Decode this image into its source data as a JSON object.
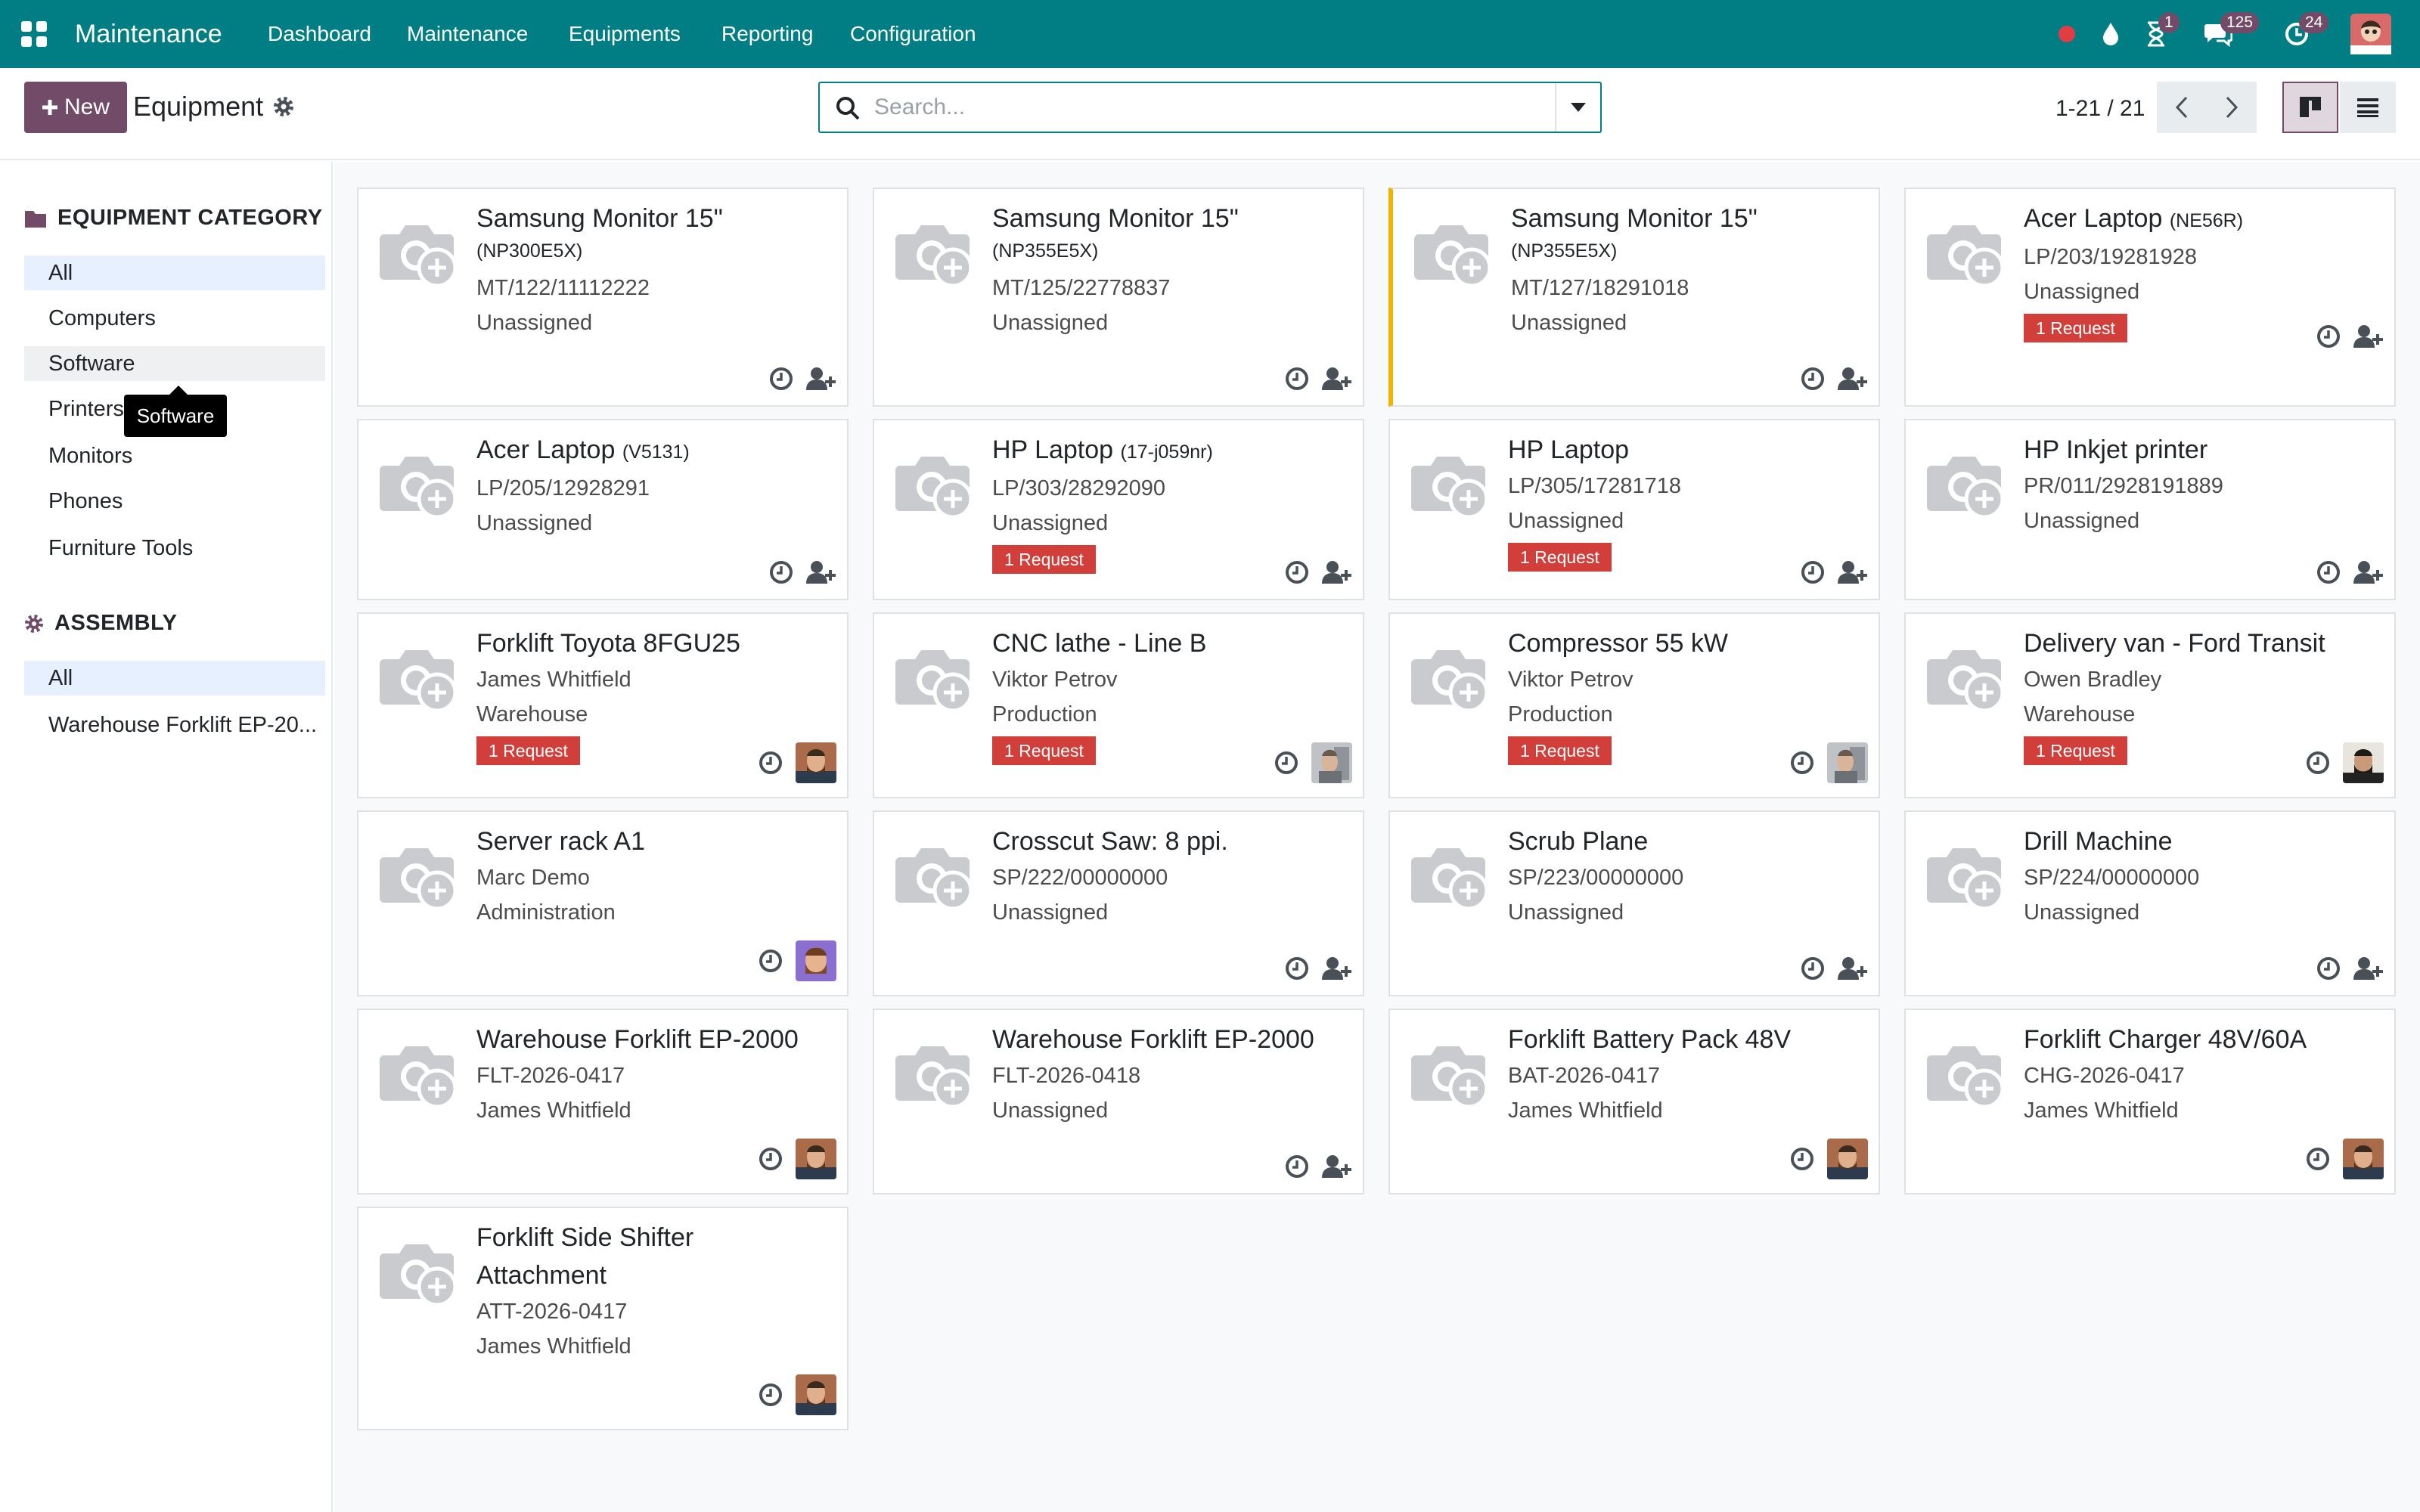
{
  "navbar": {
    "app_title": "Maintenance",
    "menu": [
      "Dashboard",
      "Maintenance",
      "Equipments",
      "Reporting",
      "Configuration"
    ],
    "activity_badge": "1",
    "messages_badge": "125",
    "updates_badge": "24"
  },
  "control_panel": {
    "new_label": "New",
    "breadcrumb": "Equipment",
    "search_placeholder": "Search...",
    "pager": "1-21 / 21"
  },
  "sidebar": {
    "category_title": "EQUIPMENT CATEGORY",
    "categories": [
      "All",
      "Computers",
      "Software",
      "Printers",
      "Monitors",
      "Phones",
      "Furniture Tools"
    ],
    "assembly_title": "ASSEMBLY",
    "assemblies": [
      "All",
      "Warehouse Forklift EP-20..."
    ],
    "tooltip": "Software"
  },
  "cards": [
    {
      "name": "Samsung Monitor 15\"",
      "model": "(NP300E5X)",
      "serial": "MT/122/11112222",
      "owner": "Unassigned"
    },
    {
      "name": "Samsung Monitor 15\"",
      "model": "(NP355E5X)",
      "serial": "MT/125/22778837",
      "owner": "Unassigned"
    },
    {
      "name": "Samsung Monitor 15\"",
      "model": "(NP355E5X)",
      "serial": "MT/127/18291018",
      "owner": "Unassigned"
    },
    {
      "name": "Acer Laptop",
      "model": "(NE56R)",
      "serial": "LP/203/19281928",
      "owner": "Unassigned",
      "request": "1 Request"
    },
    {
      "name": "Acer Laptop",
      "model": "(V5131)",
      "serial": "LP/205/12928291",
      "owner": "Unassigned"
    },
    {
      "name": "HP Laptop",
      "model": "(17-j059nr)",
      "serial": "LP/303/28292090",
      "owner": "Unassigned",
      "request": "1 Request"
    },
    {
      "name": "HP Laptop",
      "model": "",
      "serial": "LP/305/17281718",
      "owner": "Unassigned",
      "request": "1 Request"
    },
    {
      "name": "HP Inkjet printer",
      "model": "",
      "serial": "PR/011/2928191889",
      "owner": "Unassigned"
    },
    {
      "name": "Forklift Toyota 8FGU25",
      "line1": "James Whitfield",
      "line2": "Warehouse",
      "request": "1 Request"
    },
    {
      "name": "CNC lathe - Line B",
      "line1": "Viktor Petrov",
      "line2": "Production",
      "request": "1 Request"
    },
    {
      "name": "Compressor 55 kW",
      "line1": "Viktor Petrov",
      "line2": "Production",
      "request": "1 Request"
    },
    {
      "name": "Delivery van - Ford Transit",
      "line1": "Owen Bradley",
      "line2": "Warehouse",
      "request": "1 Request"
    },
    {
      "name": "Server rack A1",
      "line1": "Marc Demo",
      "line2": "Administration"
    },
    {
      "name": "Crosscut Saw: 8 ppi.",
      "line1": "SP/222/00000000",
      "line2": "Unassigned"
    },
    {
      "name": "Scrub Plane",
      "line1": "SP/223/00000000",
      "line2": "Unassigned"
    },
    {
      "name": "Drill Machine",
      "line1": "SP/224/00000000",
      "line2": "Unassigned"
    },
    {
      "name": "Warehouse Forklift EP-2000",
      "line1": "FLT-2026-0417",
      "line2": "James Whitfield"
    },
    {
      "name": "Warehouse Forklift EP-2000",
      "line1": "FLT-2026-0418",
      "line2": "Unassigned"
    },
    {
      "name": "Forklift Battery Pack 48V",
      "line1": "BAT-2026-0417",
      "line2": "James Whitfield"
    },
    {
      "name": "Forklift Charger 48V/60A",
      "line1": "CHG-2026-0417",
      "line2": "James Whitfield"
    },
    {
      "name": "Forklift Side Shifter",
      "name2": "Attachment",
      "line1": "ATT-2026-0417",
      "line2": "James Whitfield"
    }
  ],
  "icons": {
    "apps": "apps-grid-icon",
    "status": "status-dot-icon",
    "drop": "drop-icon",
    "timer": "hourglass-icon",
    "chat": "chat-icon",
    "clock": "clock-icon",
    "camera": "camera-placeholder-icon",
    "assign": "assign-user-icon"
  },
  "colors": {
    "brand": "#017e84",
    "primary": "#714b67",
    "danger": "#d23f3a",
    "highlight": "#f0b400"
  }
}
